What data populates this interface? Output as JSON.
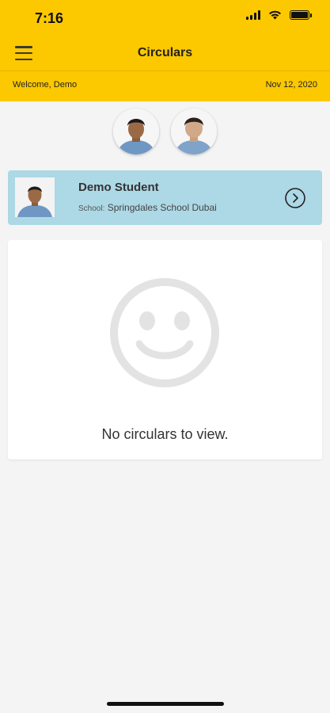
{
  "status_bar": {
    "time": "7:16"
  },
  "header": {
    "title": "Circulars",
    "welcome": "Welcome, Demo",
    "date": "Nov 12, 2020"
  },
  "icons": {
    "menu": "hamburger-menu-icon",
    "chevron": "chevron-right-circle-icon",
    "empty": "smiley-face-icon"
  },
  "student": {
    "name": "Demo Student",
    "school_label": "School:",
    "school_name": "Springdales School Dubai"
  },
  "empty_state": {
    "message": "No circulars to view."
  },
  "colors": {
    "accent": "#fcc800",
    "card_blue": "#add8e6",
    "background": "#f4f4f4"
  }
}
